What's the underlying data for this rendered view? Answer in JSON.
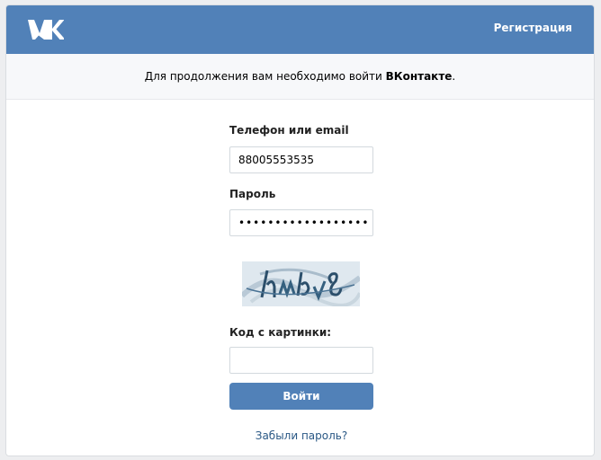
{
  "header": {
    "logo_icon": "vk-logo-icon",
    "register_label": "Регистрация"
  },
  "notice": {
    "prefix": "Для продолжения вам необходимо войти ",
    "brand": "ВКонтакте",
    "suffix": "."
  },
  "form": {
    "login_label": "Телефон или email",
    "login_value": "88005553535",
    "password_label": "Пароль",
    "password_value": "••••••••••••••••••",
    "captcha_label": "Код с картинки:",
    "captcha_value": "",
    "submit_label": "Войти",
    "forgot_label": "Забыли пароль?"
  },
  "colors": {
    "brand_blue": "#5181b8",
    "link_blue": "#2a5885",
    "page_bg": "#edeef0"
  }
}
